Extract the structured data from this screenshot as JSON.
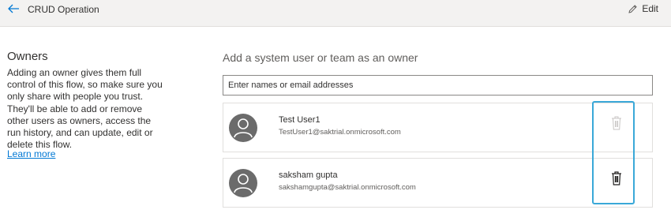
{
  "header": {
    "back_icon": "arrow-left-icon",
    "title": "CRUD Operation",
    "edit_icon": "pencil-icon",
    "edit_label": "Edit",
    "accent_color": "#0078d4"
  },
  "owners_panel": {
    "title": "Owners",
    "description": "Adding an owner gives them full control of this flow, so make sure you only share with people you trust. They'll be able to add or remove other users as owners, access the run history, and can update, edit or delete this flow.",
    "learn_more": "Learn more"
  },
  "add_owner": {
    "heading": "Add a system user or team as an owner",
    "search_placeholder": "Enter names or email addresses",
    "search_value": ""
  },
  "owners": [
    {
      "name": "Test User1",
      "email": "TestUser1@saktrial.onmicrosoft.com",
      "delete_enabled": false,
      "avatar_icon": "person-icon",
      "delete_icon": "trash-icon"
    },
    {
      "name": "saksham gupta",
      "email": "sakshamgupta@saktrial.onmicrosoft.com",
      "delete_enabled": true,
      "avatar_icon": "person-icon",
      "delete_icon": "trash-icon"
    }
  ],
  "highlight_color": "#3aa8d8"
}
